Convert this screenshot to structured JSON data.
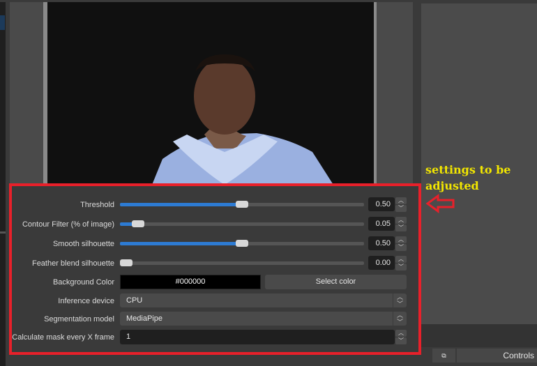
{
  "annotation": {
    "line1": "settings to be",
    "line2": "adjusted"
  },
  "filters": {
    "threshold": {
      "label": "Threshold",
      "value": "0.50",
      "fraction": 0.5
    },
    "contour": {
      "label": "Contour Filter (% of image)",
      "value": "0.05",
      "fraction": 0.07
    },
    "smooth": {
      "label": "Smooth silhouette",
      "value": "0.50",
      "fraction": 0.5
    },
    "feather": {
      "label": "Feather blend silhouette",
      "value": "0.00",
      "fraction": 0.0
    },
    "background": {
      "label": "Background Color",
      "value": "#000000",
      "button": "Select color"
    },
    "inference": {
      "label": "Inference device",
      "value": "CPU"
    },
    "model": {
      "label": "Segmentation model",
      "value": "MediaPipe"
    },
    "mask": {
      "label": "Calculate mask every X frame",
      "value": "1"
    }
  },
  "dock": {
    "controls": "Controls"
  },
  "colors": {
    "accent": "#2d7bd3",
    "highlight": "#e8202a",
    "annotation": "#f2e600"
  }
}
